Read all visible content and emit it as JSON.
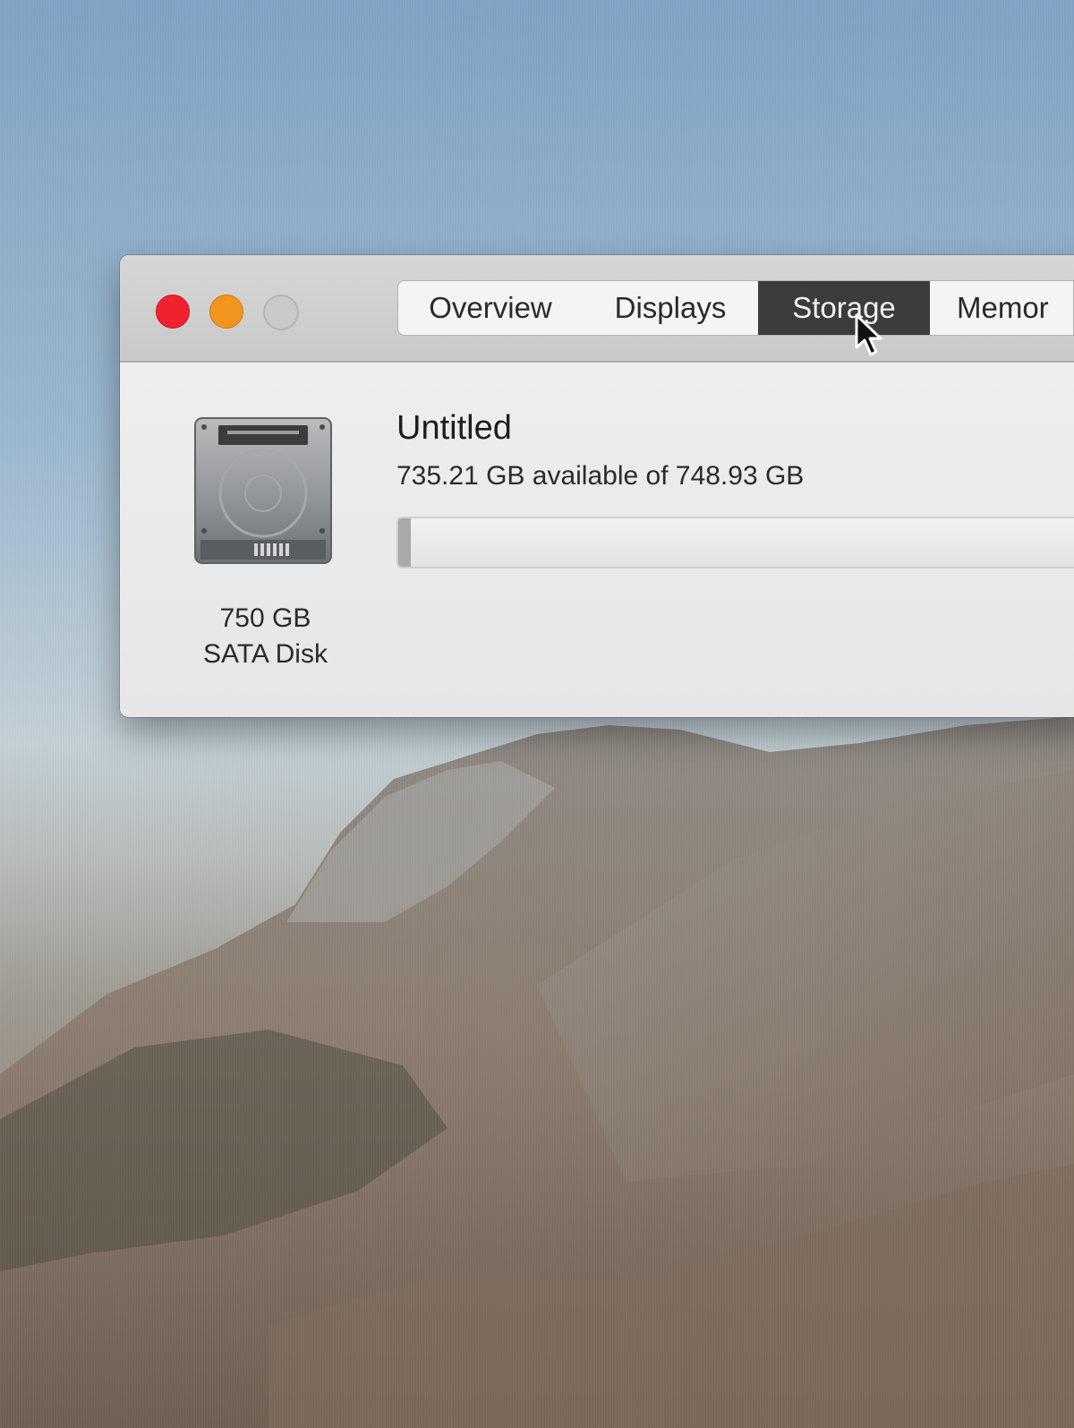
{
  "window": {
    "traffic_lights": {
      "close_color": "#f0222f",
      "minimize_color": "#f2951e",
      "zoom_color": "#c9c9c9"
    },
    "tabs": [
      {
        "label": "Overview",
        "selected": false
      },
      {
        "label": "Displays",
        "selected": false
      },
      {
        "label": "Storage",
        "selected": true
      },
      {
        "label": "Memor",
        "selected": false
      }
    ],
    "accent_selected_tab": "#3c3c3c"
  },
  "storage": {
    "disk": {
      "icon": "hard-drive-icon",
      "size_label": "750 GB",
      "type_label": "SATA Disk"
    },
    "volume": {
      "name": "Untitled",
      "availability": "735.21 GB available of 748.93 GB",
      "used_fraction": 0.018
    }
  },
  "cursor": {
    "icon": "arrow-cursor-icon"
  }
}
